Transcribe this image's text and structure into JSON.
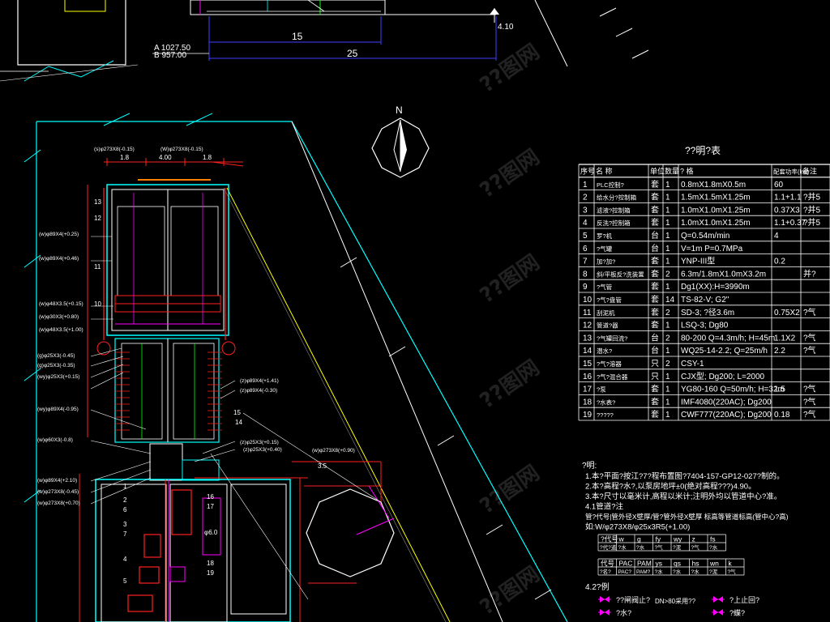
{
  "top_view": {
    "elev_a": "A 1027.50",
    "elev_b": "B 957.00",
    "dim_inner": "15",
    "dim_outer": "25",
    "elev_right": "4.10"
  },
  "compass": {
    "north_label": "N"
  },
  "equipment_table": {
    "title": "??明?表",
    "headers": [
      "序号",
      "名 称",
      "单位",
      "数量",
      "? 格",
      "配套功率(kw)",
      "备注"
    ],
    "rows": [
      [
        "1",
        "PLC控制?",
        "套",
        "1",
        "0.8mX1.8mX0.5m",
        "60",
        ""
      ],
      [
        "2",
        "给水分?控制箱",
        "套",
        "1",
        "1.5mX1.5mX1.25m",
        "1.1+1.1",
        "?并5"
      ],
      [
        "3",
        "滤液?控制箱",
        "套",
        "1",
        "1.0mX1.0mX1.25m",
        "0.37X3",
        "?并5"
      ],
      [
        "4",
        "反洗?控制箱",
        "套",
        "1",
        "1.0mX1.0mX1.25m",
        "1.1+0.37",
        "?并5"
      ],
      [
        "5",
        "罗?机",
        "台",
        "1",
        "Q=0.54m/min",
        "4",
        ""
      ],
      [
        "6",
        "?气罐",
        "台",
        "1",
        "V=1m P=0.7MPa",
        "",
        ""
      ],
      [
        "7",
        "加?加?",
        "套",
        "1",
        "YNP-III型",
        "0.2",
        ""
      ],
      [
        "8",
        "斜/平板反?洗装置",
        "套",
        "2",
        "6.3m/1.8mX1.0mX3.2m",
        "",
        "并?"
      ],
      [
        "9",
        "?气管",
        "套",
        "1",
        "Dg1(XX):H=3990m",
        "",
        ""
      ],
      [
        "10",
        "?气?盘管",
        "套",
        "14",
        "TS-82-V; G2\"",
        "",
        ""
      ],
      [
        "11",
        "刮泥机",
        "套",
        "2",
        "SD-3; ?径3.6m",
        "0.75X2",
        "?气"
      ],
      [
        "12",
        "管道?器",
        "套",
        "1",
        "LSQ-3; Dg80",
        "",
        ""
      ],
      [
        "13",
        "?气罐回流?",
        "台",
        "2",
        "80-200 Q=4.3m/h; H=45m",
        "1.1X2",
        "?气"
      ],
      [
        "14",
        "潜水?",
        "台",
        "1",
        "WQ25-14-2.2; Q=25m/h",
        "2.2",
        "?气"
      ],
      [
        "15",
        "?气?溶器",
        "只",
        "2",
        "CSY-1",
        "",
        ""
      ],
      [
        "16",
        "?气?混合器",
        "只",
        "1",
        "CJX型; Dg200; L=2000",
        "",
        ""
      ],
      [
        "17",
        "?泵",
        "套",
        "1",
        "YG80-160 Q=50m/h; H=32m",
        "1.5",
        "?气"
      ],
      [
        "18",
        "?水表?",
        "套",
        "1",
        "IMF4080(220AC); Dg200",
        "",
        "?气"
      ],
      [
        "19",
        "?????",
        "套",
        "1",
        "CWF777(220AC); Dg200",
        "0.18",
        "?气"
      ]
    ]
  },
  "notes": {
    "heading": "?明:",
    "lines": [
      "1.本?平面?按江?7?程布置图?7404-157-GP12-027?制的。",
      "2.本?高程?水?,以泵房地坪±0(绝对高程???)4.90。",
      "3.本?尺寸以毫米计,高程以米计;注明外均以管道中心?准。",
      "4.1管道?注",
      "管?代号|管外径X壁厚/管?管外径X壁厚  标高等管道标高(管中心?高)",
      "如:W/φ273X8/φ25x3R5(+1.00)"
    ],
    "code_row1": [
      "?代号",
      "w",
      "g",
      "fy",
      "wy",
      "z",
      "fs"
    ],
    "code_row1_sub": [
      "?代?道",
      "?水",
      "?水",
      "?气",
      "?泥",
      "?气",
      "?水"
    ],
    "code_row2": [
      "代号",
      "PAC",
      "PAM",
      "ys",
      "qs",
      "hs",
      "wn",
      "k"
    ],
    "code_row2_sub": [
      "?名?",
      "PAC?",
      "PAM?",
      "?水",
      "?水",
      "?水",
      "?泥",
      "?气"
    ],
    "legend_heading": "4.2?例",
    "legend": [
      {
        "label": "??闸阀止?",
        "note": "DN>80采用??"
      },
      {
        "label": "?水?"
      },
      {
        "label": "?上止回?"
      },
      {
        "label": "?蝶?"
      }
    ]
  },
  "plan_labels": {
    "pipe_tags": [
      "(s)φ273X8(-0.15)",
      "(W)φ273X8(-0.15)",
      "(w)φ89X4(+0.25)",
      "(w)φ89X4(+0.46)",
      "(w)φ48X3.5(+0.15)",
      "(w)φ30X3(+0.80)",
      "(w)φ48X3.5(+1.00)",
      "(g)φ25X3(-0.45)",
      "(g)φ25X3(-0.35)",
      "(wy)φ25X3(+0.15)",
      "(wy)φ89X4(-0.95)",
      "(w)φ60X3(-0.8)",
      "(z)φ89X4(+1.41)",
      "(z)φ89X4(-0.30)",
      "(z)φ25X3(+0.15)",
      "(z)φ25X3(+0.40)",
      "(w)φ89X4(+2.10)",
      "(w)φ273X8(-0.45)",
      "(w)φ273X8(+0.70)",
      "(w)φ273X8(+0.90)"
    ],
    "part_numbers": [
      "13",
      "12",
      "11",
      "10",
      "15",
      "14",
      "1",
      "2",
      "3",
      "4",
      "5",
      "6",
      "7",
      "16",
      "17",
      "18",
      "19"
    ],
    "dims": [
      "1.8",
      "4.00",
      "1.8",
      "3.5",
      "φ6.0"
    ]
  },
  "watermark": "??图网",
  "colors": {
    "cyan": "#00ffff",
    "red": "#ff2020",
    "magenta": "#ff00ff",
    "yellow": "#ffff00",
    "white": "#ffffff",
    "blue": "#4040ff",
    "green": "#00ff00"
  }
}
